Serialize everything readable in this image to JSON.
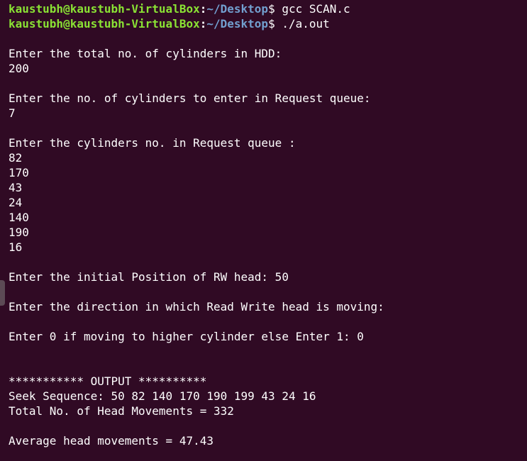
{
  "prompt": {
    "user": "kaustubh@kaustubh-VirtualBox",
    "path": "~/Desktop",
    "symbol": "$"
  },
  "commands": [
    "gcc SCAN.c",
    "./a.out"
  ],
  "output": {
    "q_total": "Enter the total no. of cylinders in HDD:",
    "a_total": "200",
    "q_count": "Enter the no. of cylinders to enter in Request queue:",
    "a_count": "7",
    "q_queue": "Enter the cylinders no. in Request queue :",
    "queue": [
      "82",
      "170",
      "43",
      "24",
      "140",
      "190",
      "16"
    ],
    "q_initial": "Enter the initial Position of RW head: 50",
    "q_direction": "Enter the direction in which Read Write head is moving:",
    "q_dir_choice": "Enter 0 if moving to higher cylinder else Enter 1: 0",
    "banner": "*********** OUTPUT **********",
    "seek_sequence": "Seek Sequence: 50 82 140 170 190 199 43 24 16",
    "total_movements": "Total No. of Head Movements = 332",
    "average": "Average head movements = 47.43"
  }
}
